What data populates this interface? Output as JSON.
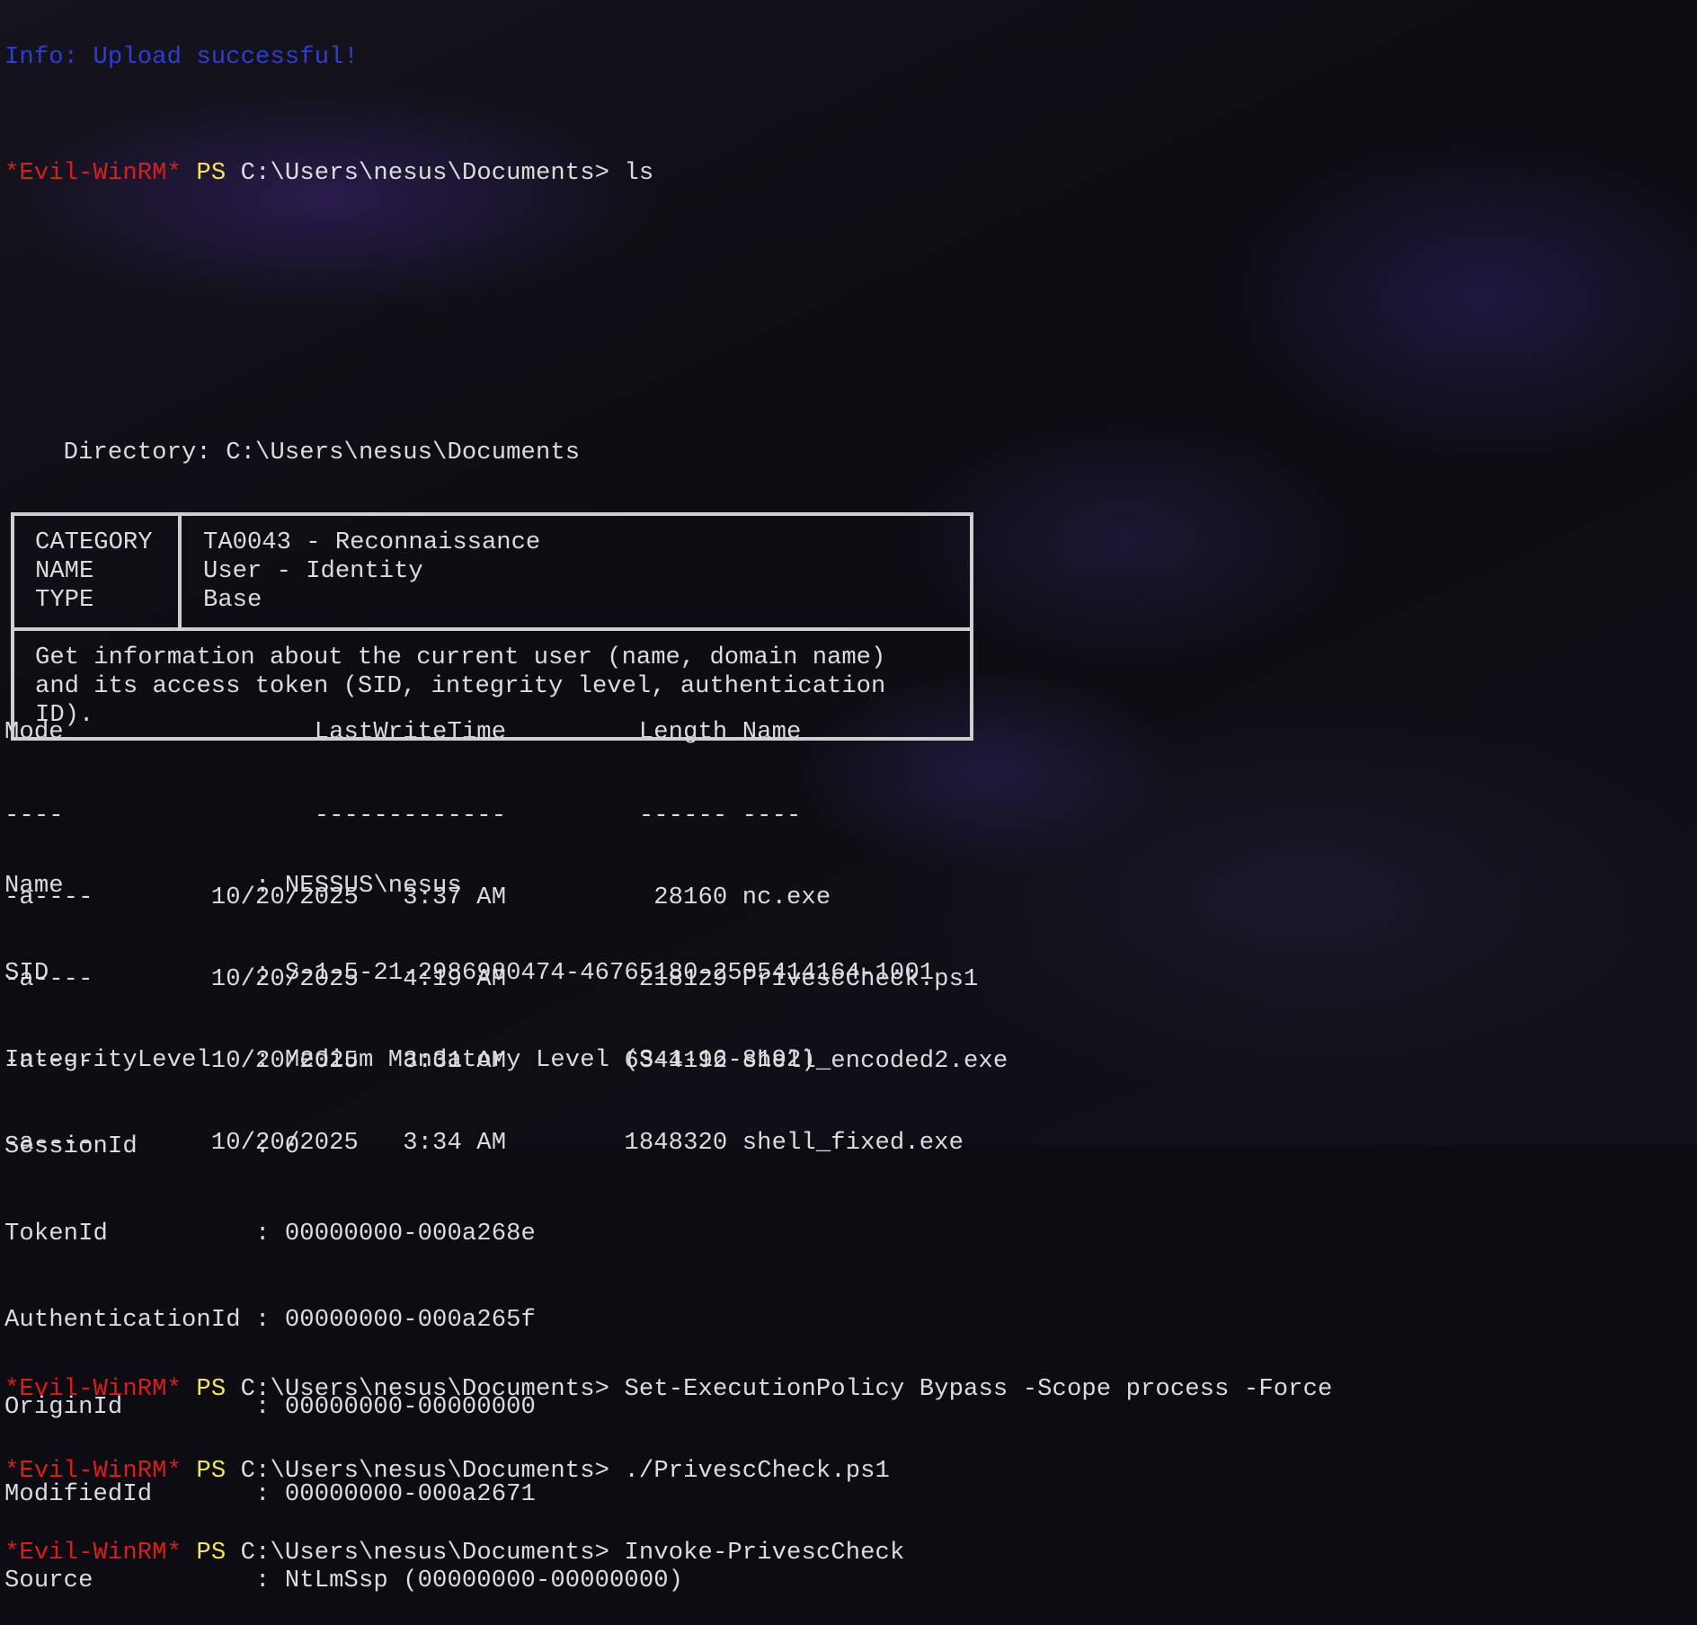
{
  "partial_top_line": "Info: Upload successful!",
  "prompt": {
    "shell": "*Evil-WinRM*",
    "ps": "PS",
    "path": "C:\\Users\\nesus\\Documents>"
  },
  "commands": {
    "ls": "ls",
    "set_policy": "Set-ExecutionPolicy Bypass -Scope process -Force",
    "run_script": "./PrivescCheck.ps1",
    "invoke": "Invoke-PrivescCheck"
  },
  "directory_line": "    Directory: C:\\Users\\nesus\\Documents",
  "listing": {
    "header": "Mode                 LastWriteTime         Length Name",
    "underline": "----                 -------------         ------ ----",
    "rows": [
      "-a----        10/20/2025   3:37 AM          28160 nc.exe",
      "-a----        10/20/2025   4:19 AM         218129 PrivescCheck.ps1",
      "-a----        10/20/2025   3:31 AM        6344192 shell_encoded2.exe",
      "-a----        10/20/2025   3:34 AM        1848320 shell_fixed.exe"
    ]
  },
  "check_box": {
    "keys": [
      "CATEGORY",
      "NAME",
      "TYPE"
    ],
    "values": [
      "TA0043 - Reconnaissance",
      "User - Identity",
      "Base"
    ],
    "description_lines": [
      "Get information about the current user (name, domain name)",
      "and its access token (SID, integrity level, authentication",
      "ID)."
    ]
  },
  "identity": [
    "Name             : NESSUS\\nesus",
    "SID              : S-1-5-21-2986980474-46765180-2505414164-1001",
    "IntegrityLevel   : Medium Mandatory Level (S-1-16-8192)",
    "SessionId        : 0",
    "TokenId          : 00000000-000a268e",
    "AuthenticationId : 00000000-000a265f",
    "OriginId         : 00000000-00000000",
    "ModifiedId       : 00000000-000a2671",
    "Source           : NtLmSsp (00000000-00000000)"
  ],
  "colors": {
    "prompt_shell": "#d81e1e",
    "prompt_ps": "#f2e45c",
    "info": "#2e3fcf",
    "text": "#dcdcdc",
    "background": "#0d0c12"
  }
}
